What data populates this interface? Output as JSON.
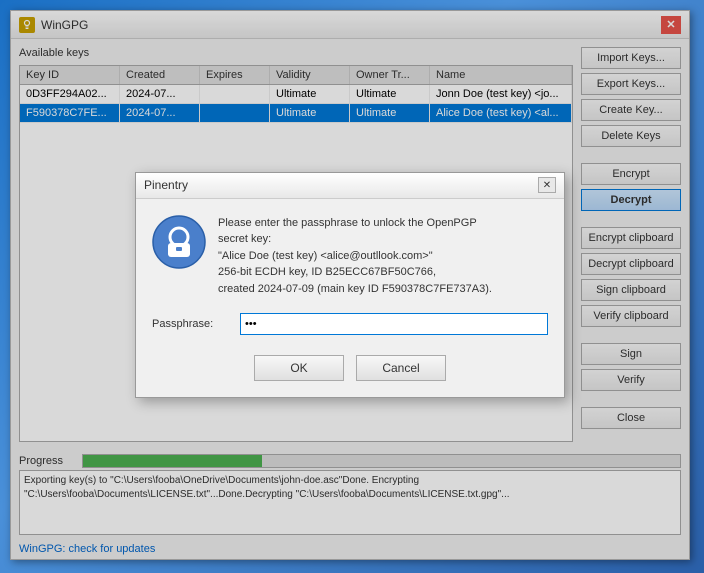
{
  "window": {
    "title": "WinGPG",
    "close_icon": "✕"
  },
  "available_keys": {
    "label": "Available keys"
  },
  "table": {
    "headers": [
      "Key ID",
      "Created",
      "Expires",
      "Validity",
      "Owner Tr...",
      "Name"
    ],
    "rows": [
      {
        "key_id": "0D3FF294A02...",
        "created": "2024-07...",
        "expires": "",
        "validity": "Ultimate",
        "owner_trust": "Ultimate",
        "name": "Jonn Doe (test key) <jo..."
      },
      {
        "key_id": "F590378C7FE...",
        "created": "2024-07...",
        "expires": "",
        "validity": "Ultimate",
        "owner_trust": "Ultimate",
        "name": "Alice Doe (test key) <al..."
      }
    ]
  },
  "buttons": {
    "import_keys": "Import Keys...",
    "export_keys": "Export Keys...",
    "create_key": "Create Key...",
    "delete_keys": "Delete Keys",
    "encrypt": "Encrypt",
    "decrypt": "Decrypt",
    "encrypt_clipboard": "Encrypt clipboard",
    "decrypt_clipboard": "Decrypt clipboard",
    "sign_clipboard": "Sign clipboard",
    "verify_clipboard": "Verify clipboard",
    "sign": "Sign",
    "verify": "Verify",
    "close": "Close"
  },
  "progress": {
    "label": "Progress",
    "value": 30
  },
  "log": {
    "text": "Exporting key(s) to \"C:\\Users\\fooba\\OneDrive\\Documents\\john-doe.asc\"Done.\nEncrypting \"C:\\Users\\fooba\\Documents\\LICENSE.txt\"...Done.Decrypting \"C:\\Users\\fooba\\Documents\\LICENSE.txt.gpg\"..."
  },
  "footer": {
    "link_text": "WinGPG: check for updates"
  },
  "dialog": {
    "title": "Pinentry",
    "message_line1": "Please enter the passphrase to unlock the OpenPGP",
    "message_line2": "secret key:",
    "message_line3": "\"Alice Doe (test key) <alice@outllook.com>\"",
    "message_line4": "256-bit ECDH key, ID B25ECC67BF50C766,",
    "message_line5": "created 2024-07-09 (main key ID F590378C7FE737A3).",
    "passphrase_label": "Passphrase:",
    "passphrase_value": "...",
    "ok_label": "OK",
    "cancel_label": "Cancel",
    "close_icon": "✕"
  }
}
